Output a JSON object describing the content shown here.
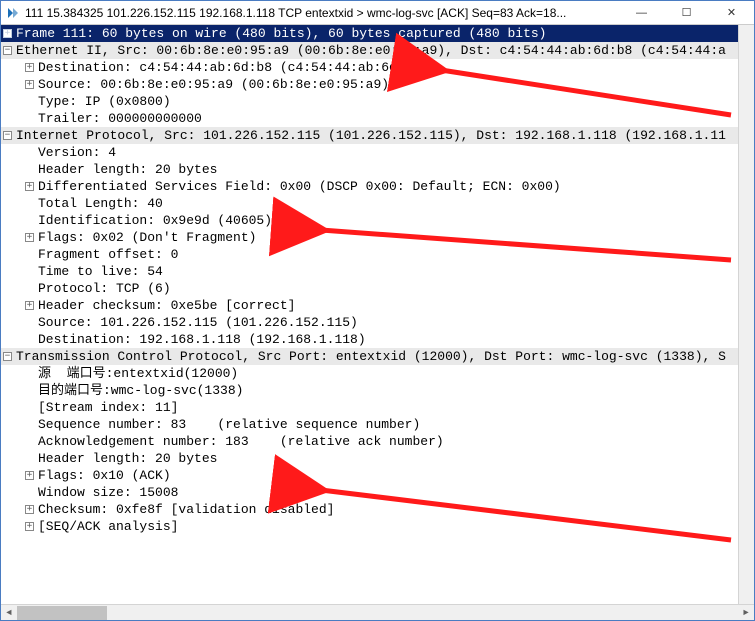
{
  "window": {
    "title": "111 15.384325 101.226.152.115 192.168.1.118 TCP entextxid > wmc-log-svc [ACK] Seq=83 Ack=18...",
    "min_glyph": "—",
    "max_glyph": "☐",
    "close_glyph": "✕"
  },
  "frame": {
    "summary": "Frame 111: 60 bytes on wire (480 bits), 60 bytes captured (480 bits)"
  },
  "eth": {
    "summary": "Ethernet II, Src: 00:6b:8e:e0:95:a9 (00:6b:8e:e0:95:a9), Dst: c4:54:44:ab:6d:b8 (c4:54:44:a",
    "dest": "Destination: c4:54:44:ab:6d:b8 (c4:54:44:ab:6d:b8)",
    "src": "Source: 00:6b:8e:e0:95:a9 (00:6b:8e:e0:95:a9)",
    "type": "Type: IP (0x0800)",
    "trailer": "Trailer: 000000000000"
  },
  "ip": {
    "summary": "Internet Protocol, Src: 101.226.152.115 (101.226.152.115), Dst: 192.168.1.118 (192.168.1.11",
    "version": "Version: 4",
    "hlen": "Header length: 20 bytes",
    "dsf": "Differentiated Services Field: 0x00 (DSCP 0x00: Default; ECN: 0x00)",
    "tlen": "Total Length: 40",
    "ident": "Identification: 0x9e9d (40605)",
    "flags": "Flags: 0x02 (Don't Fragment)",
    "foffset": "Fragment offset: 0",
    "ttl": "Time to live: 54",
    "proto": "Protocol: TCP (6)",
    "cksum": "Header checksum: 0xe5be [correct]",
    "src": "Source: 101.226.152.115 (101.226.152.115)",
    "dst": "Destination: 192.168.1.118 (192.168.1.118)"
  },
  "tcp": {
    "summary": "Transmission Control Protocol, Src Port: entextxid (12000), Dst Port: wmc-log-svc (1338), S",
    "srcport": "源  端口号:entextxid(12000)",
    "dstport": "目的端口号:wmc-log-svc(1338)",
    "stream": "[Stream index: 11]",
    "seq": "Sequence number: 83    (relative sequence number)",
    "ack": "Acknowledgement number: 183    (relative ack number)",
    "hlen": "Header length: 20 bytes",
    "flags": "Flags: 0x10 (ACK)",
    "win": "Window size: 15008",
    "cksum": "Checksum: 0xfe8f [validation disabled]",
    "seqack": "[SEQ/ACK analysis]"
  }
}
